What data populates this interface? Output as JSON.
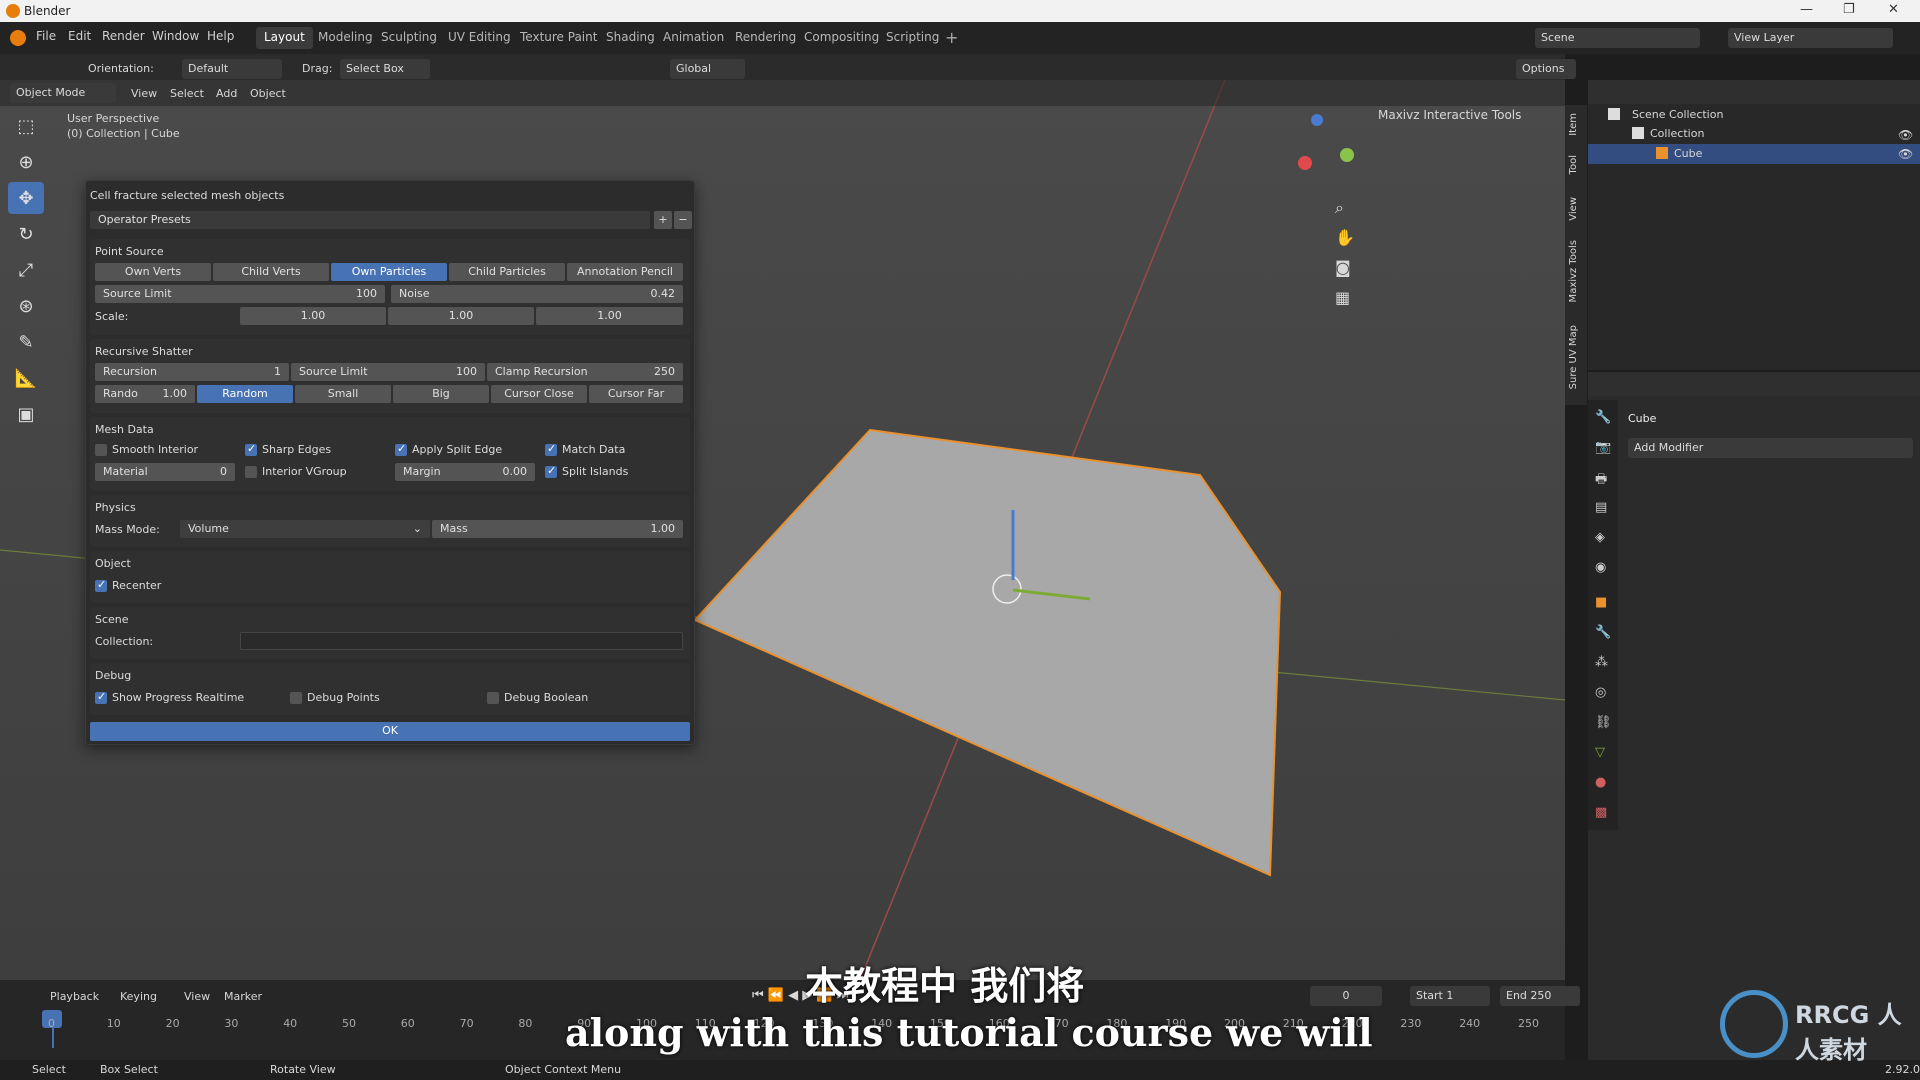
{
  "window": {
    "title": "Blender",
    "controls": [
      "—",
      "❐",
      "✕"
    ]
  },
  "menu": [
    "File",
    "Edit",
    "Render",
    "Window",
    "Help"
  ],
  "workspaces": [
    "Layout",
    "Modeling",
    "Sculpting",
    "UV Editing",
    "Texture Paint",
    "Shading",
    "Animation",
    "Rendering",
    "Compositing",
    "Scripting"
  ],
  "scene": {
    "label": "Scene",
    "view_layer": "View Layer"
  },
  "header": {
    "orientation_label": "Orientation:",
    "orientation_value": "Default",
    "drag_label": "Drag:",
    "drag_value": "Select Box",
    "transform": "Global",
    "options": "Options"
  },
  "viewport_header": {
    "mode": "Object Mode",
    "items": [
      "View",
      "Select",
      "Add",
      "Object"
    ]
  },
  "viewport": {
    "perspective": "User Perspective",
    "collection": "(0) Collection | Cube",
    "addon": "Maxivz Interactive Tools",
    "side_tabs": [
      "Item",
      "Tool",
      "View",
      "Maxivz Tools",
      "Sure UV Map"
    ]
  },
  "panel": {
    "title": "Cell fracture selected mesh objects",
    "presets": "Operator Presets",
    "point_source": {
      "heading": "Point Source",
      "buttons": [
        "Own Verts",
        "Child Verts",
        "Own Particles",
        "Child Particles",
        "Annotation Pencil"
      ],
      "active": "Own Particles",
      "source_limit_label": "Source Limit",
      "source_limit": "100",
      "noise_label": "Noise",
      "noise": "0.42",
      "scale_label": "Scale:",
      "scale": [
        "1.00",
        "1.00",
        "1.00"
      ]
    },
    "recursive": {
      "heading": "Recursive Shatter",
      "recursion_label": "Recursion",
      "recursion": "1",
      "source_limit_label": "Source Limit",
      "source_limit": "100",
      "clamp_label": "Clamp Recursion",
      "clamp": "250",
      "rando_label": "Rando",
      "rando": "1.00",
      "modes": [
        "Random",
        "Small",
        "Big",
        "Cursor Close",
        "Cursor Far"
      ],
      "active": "Random"
    },
    "mesh": {
      "heading": "Mesh Data",
      "smooth": "Smooth Interior",
      "sharp": "Sharp Edges",
      "apply_split": "Apply Split Edge",
      "match": "Match Data",
      "material_label": "Material",
      "material": "0",
      "interior_vgroup": "Interior VGroup",
      "margin_label": "Margin",
      "margin": "0.00",
      "split_islands": "Split Islands"
    },
    "physics": {
      "heading": "Physics",
      "mass_mode_label": "Mass Mode:",
      "mass_mode": "Volume",
      "mass_label": "Mass",
      "mass": "1.00"
    },
    "object": {
      "heading": "Object",
      "recenter": "Recenter"
    },
    "scene": {
      "heading": "Scene",
      "collection_label": "Collection:"
    },
    "debug": {
      "heading": "Debug",
      "progress": "Show Progress Realtime",
      "points": "Debug Points",
      "boolean": "Debug Boolean"
    },
    "ok": "OK"
  },
  "outliner": {
    "root": "Scene Collection",
    "collection": "Collection",
    "object": "Cube"
  },
  "properties": {
    "object": "Cube",
    "add_modifier": "Add Modifier"
  },
  "timeline": {
    "menus": [
      "Playback",
      "Keying",
      "View",
      "Marker"
    ],
    "current": "0",
    "start_label": "Start",
    "start": "1",
    "end_label": "End",
    "end": "250",
    "ticks": [
      "0",
      "10",
      "20",
      "30",
      "40",
      "50",
      "60",
      "70",
      "80",
      "90",
      "100",
      "110",
      "120",
      "130",
      "140",
      "150",
      "160",
      "170",
      "180",
      "190",
      "200",
      "210",
      "220",
      "230",
      "240",
      "250"
    ]
  },
  "status": {
    "select": "Select",
    "box_select": "Box Select",
    "rotate": "Rotate View",
    "context": "Object Context Menu",
    "version": "2.92.0"
  },
  "subtitles": {
    "cn": "本教程中 我们将",
    "en": "along with this tutorial course we will"
  },
  "watermark": "RRCG 人人素材"
}
